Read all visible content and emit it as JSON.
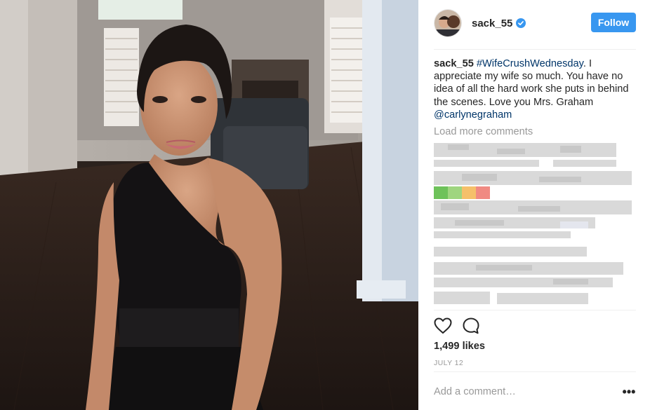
{
  "post": {
    "username": "sack_55",
    "follow_label": "Follow",
    "caption": {
      "username": "sack_55",
      "hashtag": "#WifeCrushWednesday",
      "text": ". I appreciate my wife so much. You have no idea of all the hard work she puts in behind the scenes. Love you Mrs. Graham ",
      "mention": "@carlynegraham"
    },
    "load_more": "Load more comments",
    "likes": "1,499 likes",
    "date": "JULY 12",
    "comment_placeholder": "Add a comment…",
    "more_label": "•••"
  },
  "colors": {
    "follow_button": "#3897f0",
    "link": "#003569",
    "muted": "#999999",
    "verified": "#3897f0"
  },
  "icons": {
    "like": "heart-outline-icon",
    "comment": "speech-bubble-icon",
    "verified": "verified-badge-icon"
  }
}
